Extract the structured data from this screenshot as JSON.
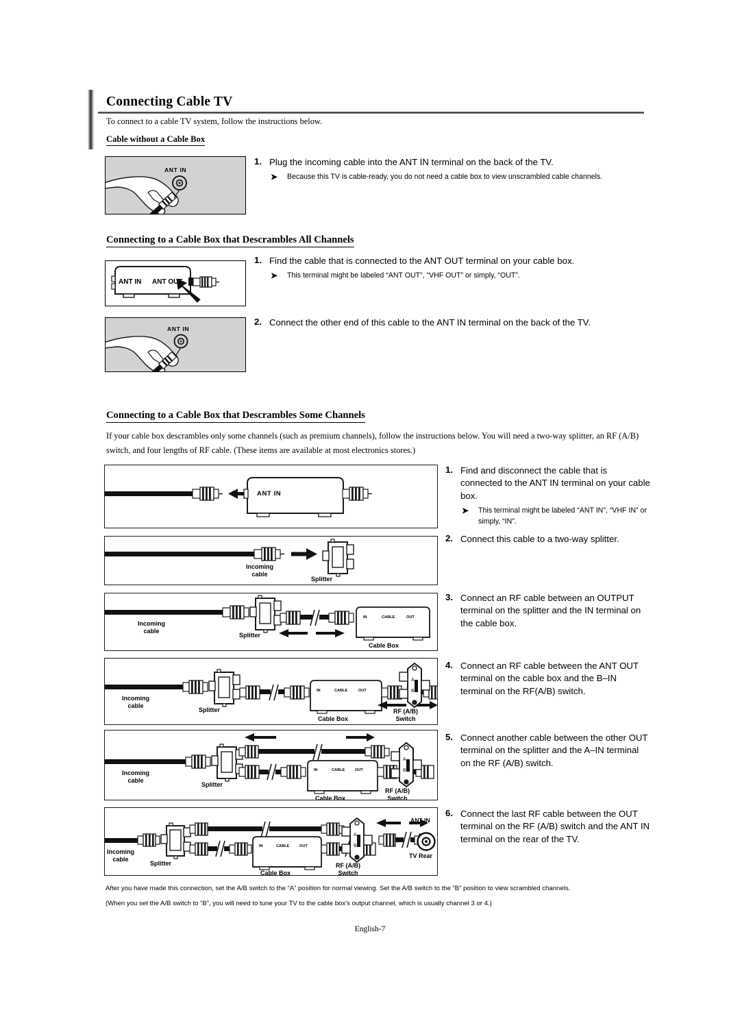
{
  "document": {
    "title": "Connecting Cable TV",
    "intro": "To connect to a cable TV system, follow the instructions below.",
    "page_number": "English-7"
  },
  "sections": {
    "no_box": {
      "heading": "Cable without a Cable Box",
      "steps": [
        {
          "num": "1.",
          "text": "Plug the incoming cable into the ANT IN terminal on the back of the TV.",
          "note": "Because this TV is cable-ready, you do not need a cable box to view unscrambled cable channels."
        }
      ],
      "figure": {
        "label_ant_in": "ANT  IN"
      }
    },
    "all_channels": {
      "heading": "Connecting to a Cable Box that Descrambles All Channels",
      "steps": [
        {
          "num": "1.",
          "text": "Find the cable that is connected to the ANT OUT terminal on your cable box.",
          "note": "This terminal might be labeled “ANT OUT”, “VHF OUT” or simply, “OUT”."
        },
        {
          "num": "2.",
          "text": "Connect the other end of this cable to the ANT IN terminal on the back of the TV.",
          "note": ""
        }
      ],
      "figure1": {
        "label_ant_in": "ANT IN",
        "label_ant_out": "ANT OUT"
      },
      "figure2": {
        "label_ant_in": "ANT IN"
      }
    },
    "some_channels": {
      "heading": "Connecting to a Cable Box that Descrambles Some Channels",
      "intro": "If your cable box descrambles only some channels (such as premium channels), follow the instructions below. You will need a two-way splitter, an RF (A/B) switch, and four lengths of RF cable. (These items are available at most electronics stores.)",
      "steps": [
        {
          "num": "1.",
          "text": "Find and disconnect the cable that is connected to the ANT IN terminal on your cable box.",
          "note": "This terminal might be labeled “ANT IN”, “VHF IN” or simply, “IN”."
        },
        {
          "num": "2.",
          "text": "Connect this cable to a two-way splitter.",
          "note": ""
        },
        {
          "num": "3.",
          "text": "Connect an RF cable between an OUTPUT terminal on the splitter and the IN terminal on the cable box.",
          "note": ""
        },
        {
          "num": "4.",
          "text": "Connect an RF cable between the ANT OUT terminal on the cable box and the B–IN terminal on the RF(A/B) switch.",
          "note": ""
        },
        {
          "num": "5.",
          "text": "Connect another cable between the other OUT terminal on the splitter and the A–IN terminal on the RF (A/B) switch.",
          "note": ""
        },
        {
          "num": "6.",
          "text": "Connect the last RF cable between the OUT terminal on the RF (A/B) switch and the ANT IN terminal on the rear of the TV.",
          "note": ""
        }
      ],
      "diagram_labels": {
        "ant_in": "ANT IN",
        "incoming_cable_line1": "Incoming",
        "incoming_cable_line2": "cable",
        "splitter": "Splitter",
        "cable_box": "Cable Box",
        "cable_box_in": "IN",
        "cable_box_cable": "CABLE",
        "cable_box_out": "OUT",
        "rf_switch_line1": "RF (A/B)",
        "rf_switch_line2": "Switch",
        "switch_a": "A",
        "switch_b": "B",
        "tv_rear": "TV Rear"
      }
    }
  },
  "footer": {
    "line1": "After you have made this connection, set the A/B switch to the “A” position for normal viewing. Set the A/B switch to the “B” position to view scrambled channels.",
    "line2": "(When you set the A/B switch to “B”, you will need to tune your TV to the cable box’s output channel, which is usually channel 3 or 4.)"
  },
  "colors": {
    "photo_background": "#d2d2d2",
    "ink": "#000000"
  }
}
